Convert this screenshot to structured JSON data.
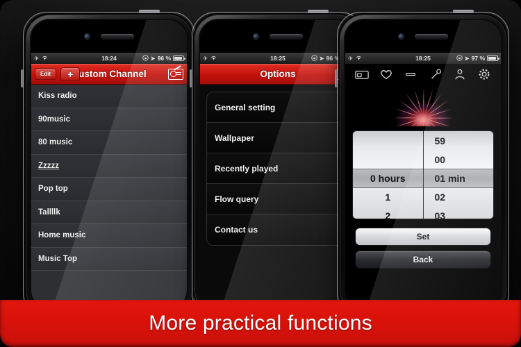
{
  "banner": {
    "text": "More practical functions"
  },
  "phones": [
    {
      "status": {
        "time": "18:24",
        "battery": "96 %",
        "airplane_icon": "airplane-icon",
        "wifi_icon": "wifi-icon",
        "lock_icon": "rotation-lock-icon",
        "location_icon": "location-arrow-icon",
        "battery_icon": "battery-icon"
      },
      "navbar": {
        "edit_label": "Edit",
        "add_label": "+",
        "title": "Custom Channel",
        "right_icon": "radio-icon"
      },
      "list": [
        {
          "label": "Kiss radio",
          "underline": false
        },
        {
          "label": "90music",
          "underline": false
        },
        {
          "label": "80 music",
          "underline": false
        },
        {
          "label": "Zzzzz",
          "underline": true
        },
        {
          "label": "Pop top",
          "underline": false
        },
        {
          "label": "Tallllk",
          "underline": false
        },
        {
          "label": "Home music",
          "underline": false
        },
        {
          "label": "Music Top",
          "underline": false
        }
      ]
    },
    {
      "status": {
        "time": "18:25",
        "battery": "96 %"
      },
      "navbar": {
        "title": "Options",
        "right_icon": "radio-icon"
      },
      "options": [
        {
          "label": "General setting"
        },
        {
          "label": "Wallpaper"
        },
        {
          "label": "Recently played"
        },
        {
          "label": "Flow query"
        },
        {
          "label": "Contact us"
        }
      ]
    },
    {
      "status": {
        "time": "18:25",
        "battery": "97 %"
      },
      "toolbar": [
        {
          "icon": "radio-card-icon"
        },
        {
          "icon": "heart-icon"
        },
        {
          "icon": "minus-icon"
        },
        {
          "icon": "microphone-icon"
        },
        {
          "icon": "person-icon"
        },
        {
          "icon": "gear-icon"
        }
      ],
      "artwork": {
        "alt": "fireworks-artwork"
      },
      "picker": {
        "hours": [
          "",
          "",
          "0 hours",
          "1",
          "2"
        ],
        "minutes": [
          "59",
          "00",
          "01 min",
          "02",
          "03"
        ],
        "selected_hours": "0 hours",
        "selected_minutes": "01 min"
      },
      "buttons": {
        "set_label": "Set",
        "back_label": "Back"
      }
    }
  ],
  "colors": {
    "brand_red": "#d8120a",
    "navbar_red": "#c2110b",
    "list_bg": "#2e2f33",
    "stage_bg": "#121212"
  }
}
